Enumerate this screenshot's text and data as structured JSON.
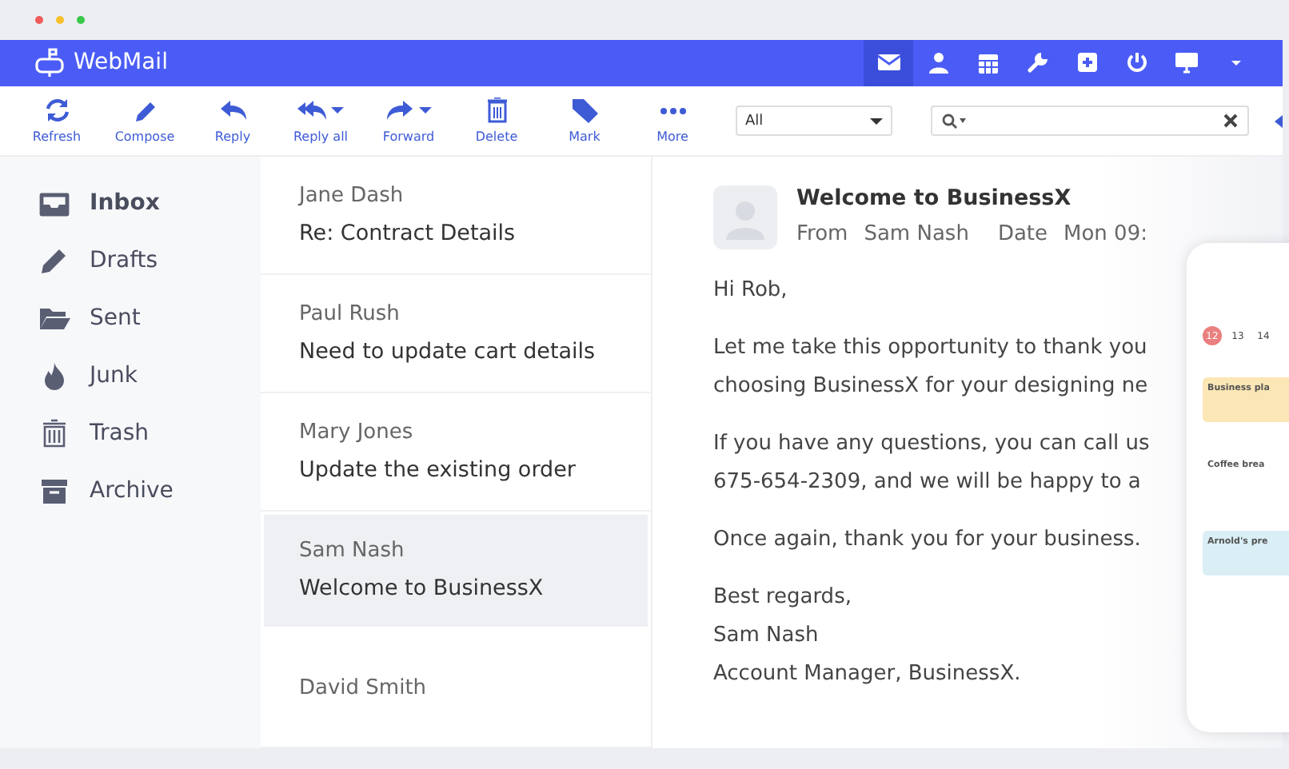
{
  "app": {
    "title": "WebMail"
  },
  "header_nav": [
    {
      "kind": "mail",
      "selected": true
    },
    {
      "kind": "user",
      "selected": false
    },
    {
      "kind": "calendar",
      "selected": false
    },
    {
      "kind": "wrench",
      "selected": false
    },
    {
      "kind": "plus",
      "selected": false
    },
    {
      "kind": "power",
      "selected": false
    },
    {
      "kind": "monitor",
      "selected": false
    },
    {
      "kind": "caret",
      "selected": false
    }
  ],
  "toolbar": [
    {
      "kind": "refresh",
      "label": "Refresh",
      "dropdown": false
    },
    {
      "kind": "compose",
      "label": "Compose",
      "dropdown": false
    },
    {
      "kind": "reply",
      "label": "Reply",
      "dropdown": false
    },
    {
      "kind": "replyall",
      "label": "Reply all",
      "dropdown": true
    },
    {
      "kind": "forward",
      "label": "Forward",
      "dropdown": true
    },
    {
      "kind": "delete",
      "label": "Delete",
      "dropdown": false
    },
    {
      "kind": "mark",
      "label": "Mark",
      "dropdown": false
    },
    {
      "kind": "more",
      "label": "More",
      "dropdown": false
    }
  ],
  "filter": {
    "value": "All"
  },
  "folders": [
    {
      "kind": "inbox",
      "label": "Inbox",
      "selected": true
    },
    {
      "kind": "drafts",
      "label": "Drafts",
      "selected": false
    },
    {
      "kind": "sent",
      "label": "Sent",
      "selected": false
    },
    {
      "kind": "junk",
      "label": "Junk",
      "selected": false
    },
    {
      "kind": "trash",
      "label": "Trash",
      "selected": false
    },
    {
      "kind": "archive",
      "label": "Archive",
      "selected": false
    }
  ],
  "messages": [
    {
      "sender": "Jane Dash",
      "subject": "Re: Contract Details",
      "selected": false
    },
    {
      "sender": "Paul Rush",
      "subject": "Need to update cart details",
      "selected": false
    },
    {
      "sender": "Mary Jones",
      "subject": "Update the existing order",
      "selected": false
    },
    {
      "sender": "Sam Nash",
      "subject": "Welcome to BusinessX",
      "selected": true
    },
    {
      "sender": "David Smith",
      "selected": false
    }
  ],
  "reading_pane": {
    "subject": "Welcome to BusinessX",
    "from_label": "From",
    "from": "Sam Nash",
    "date_label": "Date",
    "date": "Mon 09:",
    "paragraphs": [
      "Hi Rob,",
      "Let me take this opportunity to thank you\nchoosing BusinessX for your designing ne",
      "If you have any questions, you can call us\n675-654-2309, and we will be happy to a",
      "Once again, thank you for your business.",
      "Best regards,\nSam Nash\nAccount Manager, BusinessX."
    ]
  },
  "phone": {
    "days": [
      {
        "label": "12",
        "selected": true
      },
      {
        "label": "13",
        "selected": false
      },
      {
        "label": "14",
        "selected": false
      }
    ],
    "events": [
      {
        "title": "Business pla",
        "color": "#fbe7b5"
      },
      {
        "title": "Coffee brea",
        "color": "#ffffff"
      },
      {
        "title": "Arnold's pre",
        "color": "#d9eef5"
      }
    ]
  }
}
